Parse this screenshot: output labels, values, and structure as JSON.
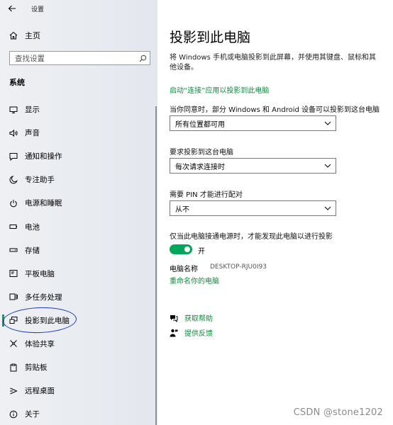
{
  "window": {
    "title": "设置"
  },
  "sidebar": {
    "home_label": "主页",
    "search_placeholder": "查找设置",
    "section_title": "系统",
    "items": [
      {
        "label": "显示",
        "icon": "monitor-icon"
      },
      {
        "label": "声音",
        "icon": "speaker-icon"
      },
      {
        "label": "通知和操作",
        "icon": "message-icon"
      },
      {
        "label": "专注助手",
        "icon": "moon-icon"
      },
      {
        "label": "电源和睡眠",
        "icon": "power-icon"
      },
      {
        "label": "电池",
        "icon": "battery-icon"
      },
      {
        "label": "存储",
        "icon": "storage-icon"
      },
      {
        "label": "平板电脑",
        "icon": "tablet-icon"
      },
      {
        "label": "多任务处理",
        "icon": "multitask-icon"
      },
      {
        "label": "投影到此电脑",
        "icon": "project-icon",
        "active": true
      },
      {
        "label": "体验共享",
        "icon": "share-icon"
      },
      {
        "label": "剪贴板",
        "icon": "clipboard-icon"
      },
      {
        "label": "远程桌面",
        "icon": "remote-icon"
      },
      {
        "label": "关于",
        "icon": "info-icon"
      }
    ]
  },
  "main": {
    "title": "投影到此电脑",
    "description": "将 Windows 手机或电脑投影到此屏幕，并使用其键盘、鼠标和其他设备。",
    "launch_link": "启动“连接”应用以投影到此电脑",
    "setting1_label": "当你同意时，部分 Windows 和 Android 设备可以投影到这台电脑",
    "setting1_value": "所有位置都可用",
    "setting2_label": "要求投影到这台电脑",
    "setting2_value": "每次请求连接时",
    "setting3_label": "需要 PIN 才能进行配对",
    "setting3_value": "从不",
    "power_label": "仅当此电脑接通电源时，才能发现此电脑以进行投影",
    "toggle_state": "开",
    "pc_name_label": "电脑名称",
    "pc_name_value": "DESKTOP-RJU0I93",
    "rename_link": "重命名你的电脑",
    "help_label": "获取帮助",
    "feedback_label": "提供反馈"
  },
  "watermark": "CSDN @stone1202",
  "colors": {
    "accent": "#10893e",
    "toggle": "#00a65a",
    "annotation": "#1a3aa8"
  }
}
